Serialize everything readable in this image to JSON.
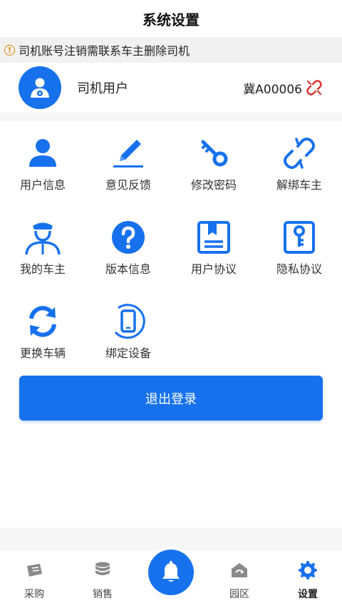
{
  "header": {
    "title": "系统设置"
  },
  "notice": {
    "text": "司机账号注销需联系车主删除司机"
  },
  "user": {
    "name": "司机用户",
    "plate": "冀A00006"
  },
  "menu": [
    {
      "label": "用户信息",
      "icon": "user-icon"
    },
    {
      "label": "意见反馈",
      "icon": "pencil-icon"
    },
    {
      "label": "修改密码",
      "icon": "key-icon"
    },
    {
      "label": "解绑车主",
      "icon": "unlink-icon"
    },
    {
      "label": "我的车主",
      "icon": "driver-icon"
    },
    {
      "label": "版本信息",
      "icon": "question-icon"
    },
    {
      "label": "用户协议",
      "icon": "document-icon"
    },
    {
      "label": "隐私协议",
      "icon": "key-card-icon"
    },
    {
      "label": "更换车辆",
      "icon": "refresh-icon"
    },
    {
      "label": "绑定设备",
      "icon": "phone-icon"
    }
  ],
  "logout": {
    "label": "退出登录"
  },
  "tabbar": [
    {
      "label": "采购",
      "icon": "ticket-icon"
    },
    {
      "label": "销售",
      "icon": "coins-icon"
    },
    {
      "label": "园区",
      "icon": "home-icon"
    },
    {
      "label": "设置",
      "icon": "gear-icon"
    }
  ],
  "colors": {
    "accent": "#1771ed",
    "warning": "#e08a00",
    "unlink": "#d9302c"
  }
}
